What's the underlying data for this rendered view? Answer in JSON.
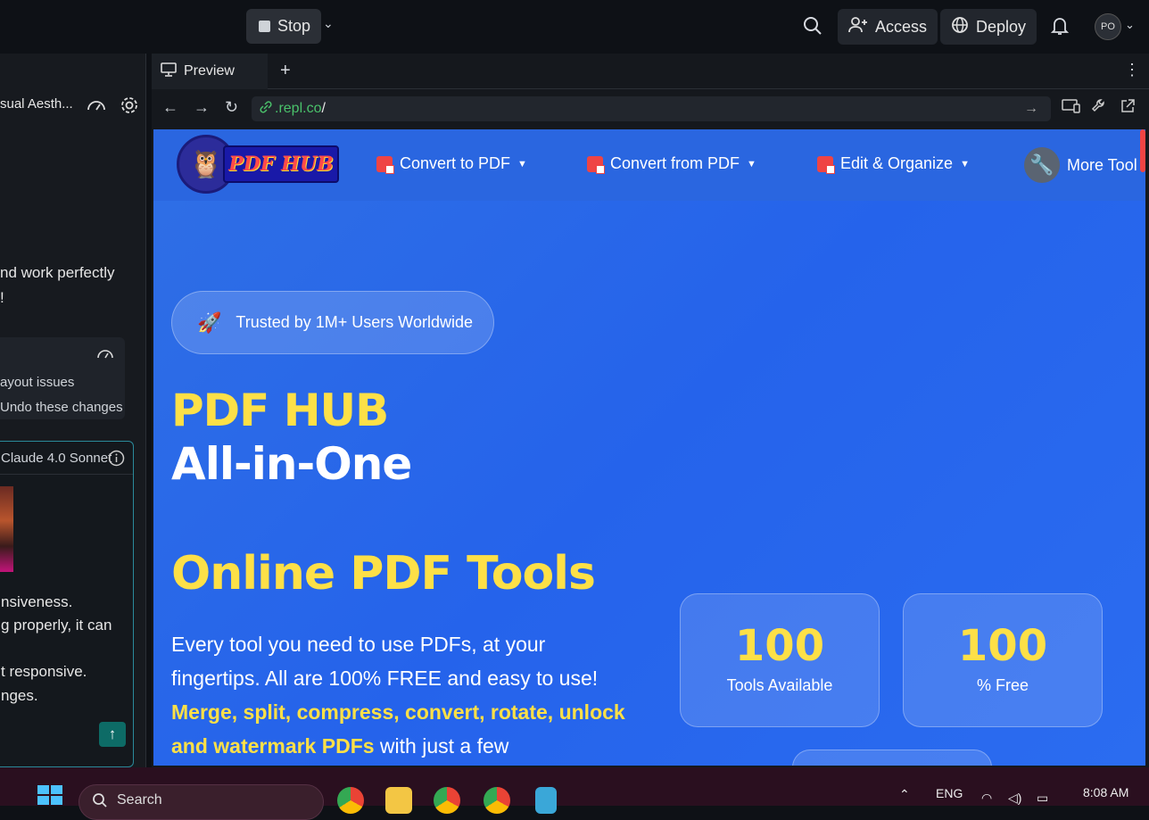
{
  "topbar": {
    "stop_label": "Stop",
    "access_label": "Access",
    "deploy_label": "Deploy",
    "avatar_initials": "PO"
  },
  "left_panel": {
    "title": "sual Aesth...",
    "msg_line1": "nd work perfectly",
    "msg_line2": "!",
    "card_line1": "ayout issues",
    "card_line2": "Undo these changes",
    "model_label": "Claude 4.0 Sonnet",
    "text_line1": "nsiveness.",
    "text_line2": "g properly, it can",
    "text_line3": "t responsive.",
    "text_line4": "nges."
  },
  "preview": {
    "tab_label": "Preview",
    "url_host": ".repl.co",
    "url_path": "/"
  },
  "site": {
    "logo_text": "PDF HUB",
    "nav": [
      {
        "label": "Convert to PDF"
      },
      {
        "label": "Convert from PDF"
      },
      {
        "label": "Edit & Organize"
      },
      {
        "label": "More Tool"
      }
    ],
    "badge_text": "Trusted by 1M+ Users Worldwide",
    "headline_1": "PDF HUB",
    "headline_2": "All-in-One",
    "headline_3": "Online PDF Tools",
    "desc_plain_1": "Every tool you need to use PDFs, at your fingertips. All are 100% FREE and easy to use!",
    "desc_highlight": "Merge, split, compress, convert, rotate, unlock and watermark PDFs",
    "desc_plain_2": " with just a few",
    "stats": [
      {
        "value": "100",
        "label": "Tools Available"
      },
      {
        "value": "100",
        "label": "% Free"
      }
    ]
  },
  "taskbar": {
    "search_label": "Search",
    "lang": "ENG",
    "time": "8:08 AM"
  },
  "colors": {
    "site_blue": "#2563eb",
    "headline_yellow": "#fde047",
    "url_green": "#4ac26b"
  }
}
